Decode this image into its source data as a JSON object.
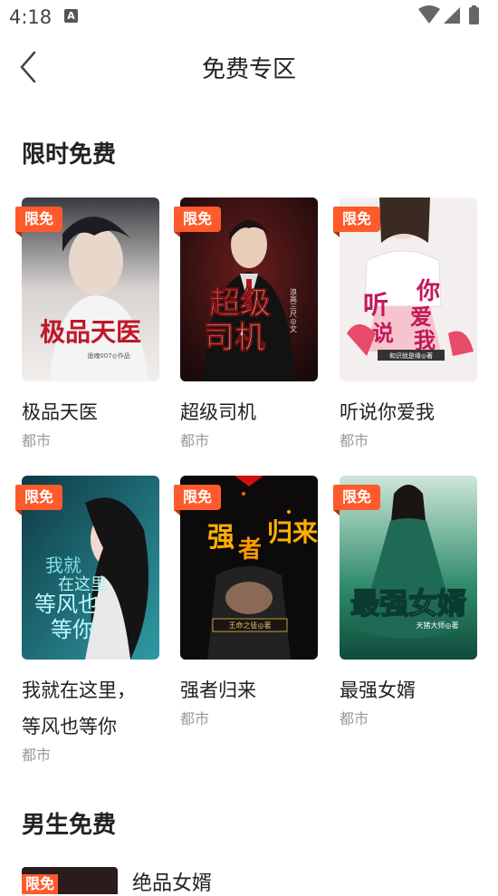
{
  "status": {
    "time": "4:18",
    "notif_icon": "A"
  },
  "nav": {
    "title": "免费专区"
  },
  "sections": {
    "limited": {
      "title": "限时免费"
    },
    "male": {
      "title": "男生免费"
    }
  },
  "badge_label": "限免",
  "books": [
    {
      "title": "极品天医",
      "category": "都市",
      "cover_text": "极品天医",
      "author": "诡魂007◎作品"
    },
    {
      "title": "超级司机",
      "category": "都市",
      "cover_text": "超级司机",
      "author": "浪高三尺◎文"
    },
    {
      "title": "听说你爱我",
      "category": "都市",
      "cover_text": "听说你爱我",
      "author": "和识就是缘◎著"
    },
    {
      "title": "我就在这里，等风也等你",
      "title_line1": "我就在这里，",
      "title_line2": "等风也等你",
      "category": "都市",
      "cover_text": "我就在这里等风也等你"
    },
    {
      "title": "强者归来",
      "category": "都市",
      "cover_text": "强者归来",
      "author": "王命之徒◎著"
    },
    {
      "title": "最强女婿",
      "category": "都市",
      "cover_text": "最强女婿",
      "author": "天猪大师◎著"
    }
  ],
  "male_list": [
    {
      "title": "绝品女婿"
    }
  ],
  "colors": {
    "accent": "#ff5a2c",
    "text": "#222222",
    "muted": "#999999"
  }
}
